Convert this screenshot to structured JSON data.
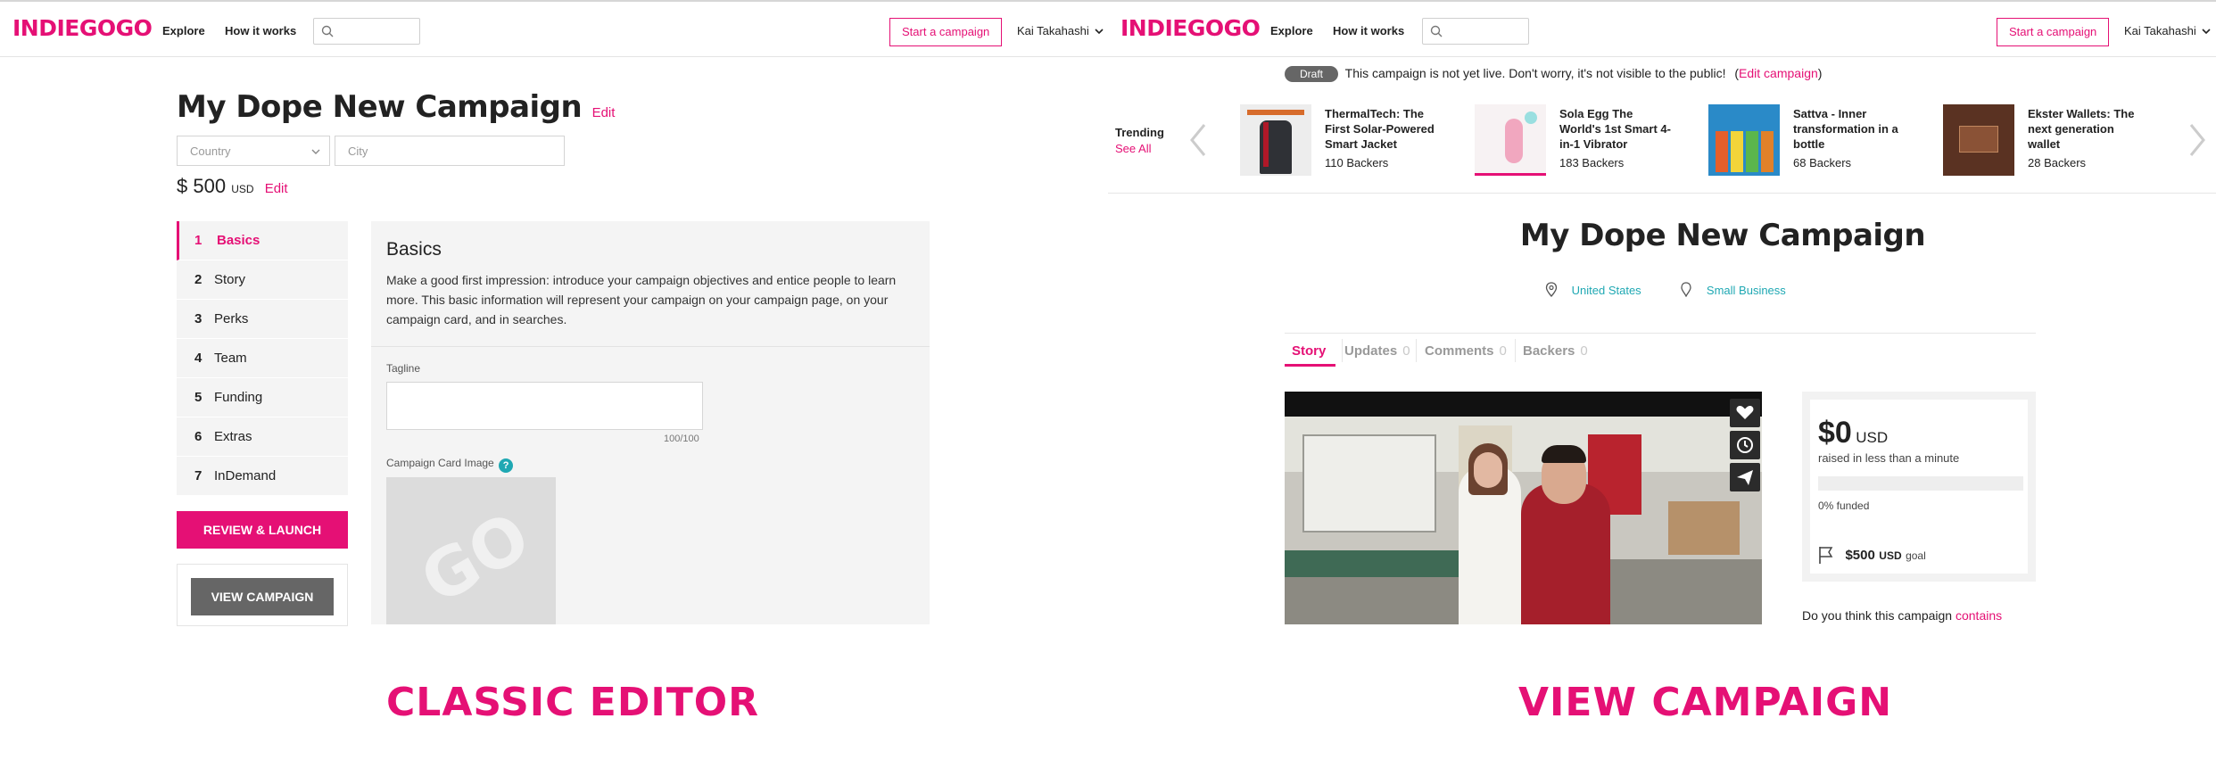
{
  "brand": {
    "logo": "INDIEGOGO",
    "accent": "#e51075"
  },
  "nav": {
    "explore": "Explore",
    "how_it_works": "How it works",
    "search_placeholder": "",
    "start_campaign": "Start a campaign",
    "user": "Kai Takahashi"
  },
  "editor": {
    "campaign_title": "My Dope New Campaign",
    "title_edit": "Edit",
    "country_placeholder": "Country",
    "city_placeholder": "City",
    "goal_symbol": "$",
    "goal_amount": "500",
    "goal_currency": "USD",
    "goal_edit": "Edit",
    "steps": [
      {
        "num": "1",
        "label": "Basics"
      },
      {
        "num": "2",
        "label": "Story"
      },
      {
        "num": "3",
        "label": "Perks"
      },
      {
        "num": "4",
        "label": "Team"
      },
      {
        "num": "5",
        "label": "Funding"
      },
      {
        "num": "6",
        "label": "Extras"
      },
      {
        "num": "7",
        "label": "InDemand"
      }
    ],
    "review_launch": "REVIEW & LAUNCH",
    "view_campaign": "VIEW CAMPAIGN",
    "section_title": "Basics",
    "section_description": "Make a good first impression: introduce your campaign objectives and entice people to learn more. This basic information will represent your campaign on your campaign page, on your campaign card, and in searches.",
    "tagline_label": "Tagline",
    "tagline_value": "",
    "tagline_counter": "100/100",
    "card_image_label": "Campaign Card Image",
    "card_image_placeholder": "GO"
  },
  "view": {
    "draft_badge": "Draft",
    "draft_notice": "This campaign is not yet live. Don't worry, it's not visible to the public!",
    "draft_edit_open": "(",
    "draft_edit_link": "Edit campaign",
    "draft_edit_close": ")",
    "trending_label": "Trending",
    "see_all": "See All",
    "trending": [
      {
        "title": "ThermalTech: The First Solar-Powered Smart Jacket",
        "backers": "110 Backers"
      },
      {
        "title": "Sola Egg The World's 1st Smart 4-in-1 Vibrator",
        "backers": "183 Backers"
      },
      {
        "title": "Sattva - Inner transformation in a bottle",
        "backers": "68 Backers"
      },
      {
        "title": "Ekster Wallets: The next generation wallet",
        "backers": "28 Backers"
      }
    ],
    "campaign_title": "My Dope New Campaign",
    "location": "United States",
    "category": "Small Business",
    "tabs": [
      {
        "label": "Story",
        "count": ""
      },
      {
        "label": "Updates",
        "count": "0"
      },
      {
        "label": "Comments",
        "count": "0"
      },
      {
        "label": "Backers",
        "count": "0"
      }
    ],
    "raised_amount": "$0",
    "raised_currency": "USD",
    "raised_time": "raised in less than a minute",
    "funded_pct": 0,
    "funded_text": "0% funded",
    "goal_amount": "$500",
    "goal_currency": "USD",
    "goal_word": "goal",
    "report_text": "Do you think this campaign",
    "report_link": "contains"
  },
  "captions": {
    "left": "CLASSIC EDITOR",
    "right": "VIEW CAMPAIGN"
  }
}
